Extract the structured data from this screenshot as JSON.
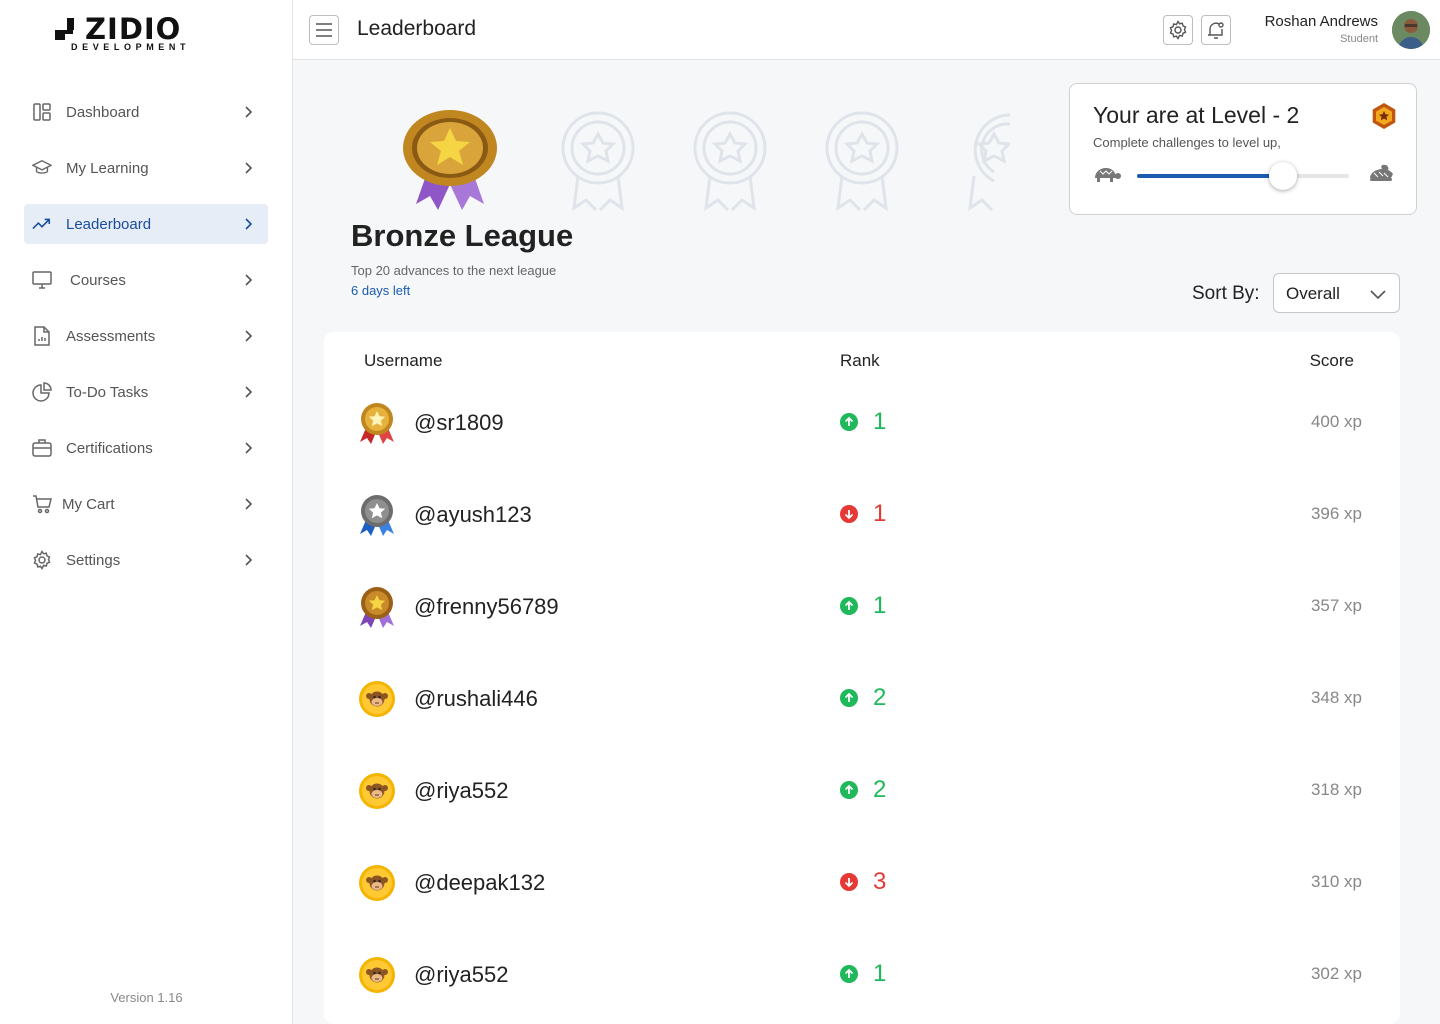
{
  "brand": {
    "name": "ZIDIO",
    "sub": "DEVELOPMENT"
  },
  "sidebar": {
    "items": [
      {
        "label": "Dashboard",
        "icon": "dashboard-icon",
        "active": false
      },
      {
        "label": "My Learning",
        "icon": "graduation-cap-icon",
        "active": false
      },
      {
        "label": "Leaderboard",
        "icon": "trending-up-icon",
        "active": true
      },
      {
        "label": "Courses",
        "icon": "monitor-icon",
        "active": false
      },
      {
        "label": "Assessments",
        "icon": "document-chart-icon",
        "active": false
      },
      {
        "label": "To-Do Tasks",
        "icon": "pie-chart-icon",
        "active": false
      },
      {
        "label": "Certifications",
        "icon": "briefcase-icon",
        "active": false
      },
      {
        "label": "My Cart",
        "icon": "cart-icon",
        "active": false
      },
      {
        "label": "Settings",
        "icon": "gear-icon",
        "active": false
      }
    ],
    "version": "Version 1.16"
  },
  "header": {
    "title": "Leaderboard",
    "user_name": "Roshan Andrews",
    "user_role": "Student"
  },
  "league": {
    "title": "Bronze League",
    "subtitle": "Top 20 advances to the next league",
    "days_left": "6 days left"
  },
  "level": {
    "title": "Your are at Level - 2",
    "subtitle": "Complete challenges to level up,",
    "progress": 0.69
  },
  "sort": {
    "label": "Sort By:",
    "value": "Overall"
  },
  "table": {
    "headers": {
      "username": "Username",
      "rank": "Rank",
      "score": "Score"
    },
    "rows": [
      {
        "username": "@sr1809",
        "rank": "1",
        "direction": "up",
        "score": "400 xp",
        "badge": "gold-medal-icon"
      },
      {
        "username": "@ayush123",
        "rank": "1",
        "direction": "down",
        "score": "396 xp",
        "badge": "silver-medal-icon"
      },
      {
        "username": "@frenny56789",
        "rank": "1",
        "direction": "up",
        "score": "357 xp",
        "badge": "bronze-medal-icon"
      },
      {
        "username": "@rushali446",
        "rank": "2",
        "direction": "up",
        "score": "348 xp",
        "badge": "monkey-icon"
      },
      {
        "username": "@riya552",
        "rank": "2",
        "direction": "up",
        "score": "318 xp",
        "badge": "monkey-icon"
      },
      {
        "username": "@deepak132",
        "rank": "3",
        "direction": "down",
        "score": "310 xp",
        "badge": "monkey-icon"
      },
      {
        "username": "@riya552",
        "rank": "1",
        "direction": "up",
        "score": "302 xp",
        "badge": "monkey-icon"
      }
    ]
  },
  "colors": {
    "accent": "#1a5bb0",
    "up": "#1fb85a",
    "down": "#e53935"
  }
}
